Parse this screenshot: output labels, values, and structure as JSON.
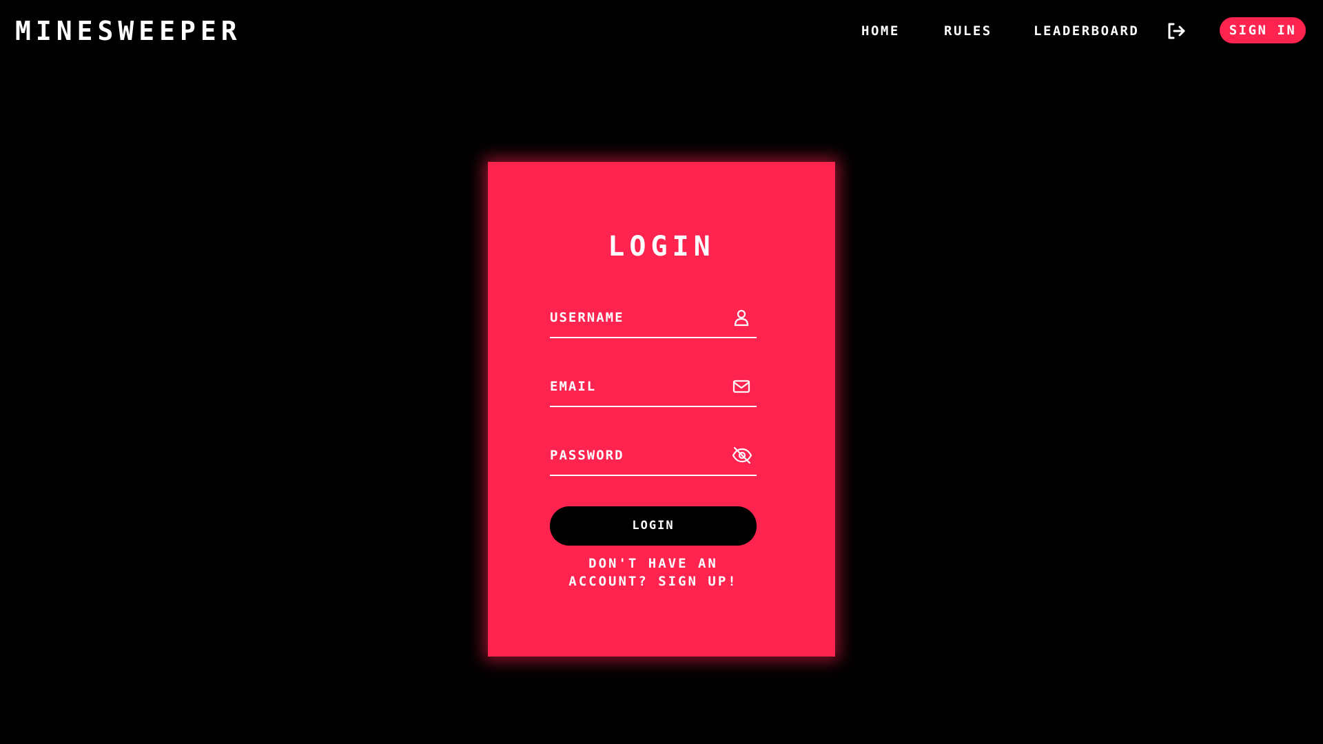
{
  "nav": {
    "brand": "MINESWEEPER",
    "links": [
      "HOME",
      "RULES",
      "LEADERBOARD"
    ],
    "logout_icon": "logout-icon",
    "signin_label": "SIGN IN"
  },
  "login_card": {
    "title": "LOGIN",
    "username_placeholder": "USERNAME",
    "email_placeholder": "EMAIL",
    "password_placeholder": "PASSWORD",
    "username_icon": "user-icon",
    "email_icon": "mail-icon",
    "password_icon": "eye-off-icon",
    "submit_label": "LOGIN",
    "signup_prompt": "DON'T HAVE AN ACCOUNT? SIGN UP!"
  },
  "colors": {
    "background": "#000000",
    "accent": "#ff2350",
    "text": "#ffffff"
  }
}
